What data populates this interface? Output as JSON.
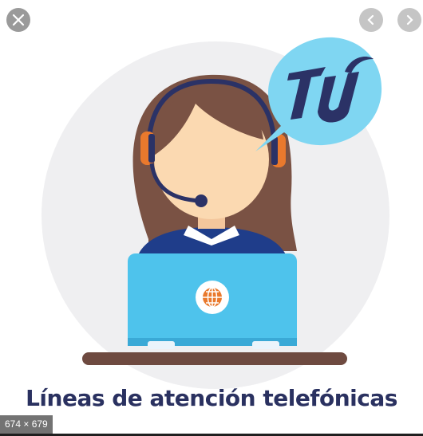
{
  "viewer": {
    "close_icon": "close-icon",
    "prev_icon": "chevron-left-icon",
    "next_icon": "chevron-right-icon",
    "image_size": "674 × 679"
  },
  "image": {
    "caption": "Líneas de atención telefónicas",
    "bubble_logo": "TU",
    "colors": {
      "bubble": "#7fd6f2",
      "logo": "#2b3266",
      "hair": "#7a5244",
      "skin": "#fbd9b1",
      "laptop": "#4ec3ec",
      "uniform": "#1f3d8a",
      "headset": "#e9792d",
      "desk": "#6e4a40",
      "background_circle": "#efeff1"
    }
  }
}
